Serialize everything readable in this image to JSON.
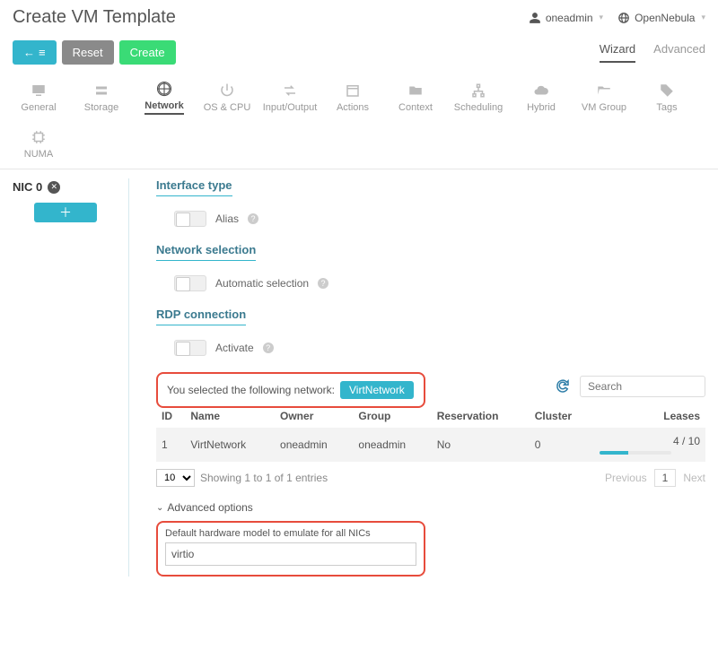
{
  "header": {
    "title": "Create VM Template",
    "user": "oneadmin",
    "brand": "OpenNebula"
  },
  "toolbar": {
    "back_icon": "←",
    "reset_label": "Reset",
    "create_label": "Create"
  },
  "mode_tabs": {
    "wizard": "Wizard",
    "advanced": "Advanced"
  },
  "section_tabs": {
    "general": "General",
    "storage": "Storage",
    "network": "Network",
    "oscpu": "OS & CPU",
    "io": "Input/Output",
    "actions": "Actions",
    "context": "Context",
    "scheduling": "Scheduling",
    "hybrid": "Hybrid",
    "vmgroup": "VM Group",
    "tags": "Tags",
    "numa": "NUMA"
  },
  "nic_sidebar": {
    "nic0": "NIC 0"
  },
  "sections": {
    "interface_type": "Interface type",
    "alias": "Alias",
    "network_selection": "Network selection",
    "auto_selection": "Automatic selection",
    "rdp": "RDP connection",
    "activate": "Activate"
  },
  "selection": {
    "prefix": "You selected the following network:",
    "network": "VirtNetwork"
  },
  "search": {
    "placeholder": "Search"
  },
  "table": {
    "headers": {
      "id": "ID",
      "name": "Name",
      "owner": "Owner",
      "group": "Group",
      "reservation": "Reservation",
      "cluster": "Cluster",
      "leases": "Leases"
    },
    "rows": [
      {
        "id": "1",
        "name": "VirtNetwork",
        "owner": "oneadmin",
        "group": "oneadmin",
        "reservation": "No",
        "cluster": "0",
        "leases": "4 / 10",
        "lease_pct": 40
      }
    ],
    "page_size": "10",
    "showing": "Showing 1 to 1 of 1 entries",
    "prev": "Previous",
    "page": "1",
    "next": "Next"
  },
  "advanced": {
    "toggle": "Advanced options",
    "model_label": "Default hardware model to emulate for all NICs",
    "model_value": "virtio"
  }
}
